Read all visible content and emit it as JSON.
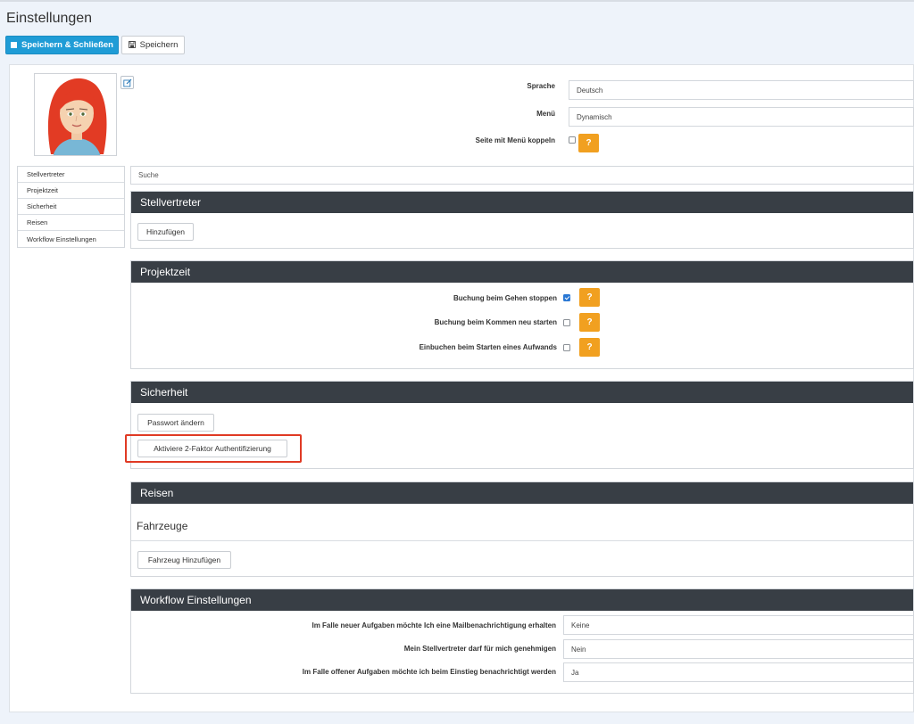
{
  "page": {
    "title": "Einstellungen"
  },
  "toolbar": {
    "save_close_label": "Speichern & Schließen",
    "save_label": "Speichern"
  },
  "profile": {
    "language": {
      "label": "Sprache",
      "value": "Deutsch"
    },
    "menu": {
      "label": "Menü",
      "value": "Dynamisch"
    },
    "couple": {
      "label": "Seite mit Menü koppeln",
      "checked": false
    }
  },
  "sidebar": {
    "items": [
      {
        "label": "Stellvertreter"
      },
      {
        "label": "Projektzeit"
      },
      {
        "label": "Sicherheit"
      },
      {
        "label": "Reisen"
      },
      {
        "label": "Workflow Einstellungen"
      }
    ]
  },
  "search": {
    "placeholder": "Suche"
  },
  "sections": {
    "stellvertreter": {
      "title": "Stellvertreter",
      "add_label": "Hinzufügen"
    },
    "projektzeit": {
      "title": "Projektzeit",
      "options": [
        {
          "label": "Buchung beim Gehen stoppen",
          "checked": true
        },
        {
          "label": "Buchung beim Kommen neu starten",
          "checked": false
        },
        {
          "label": "Einbuchen beim Starten eines Aufwands",
          "checked": false
        }
      ]
    },
    "sicherheit": {
      "title": "Sicherheit",
      "change_password_label": "Passwort ändern",
      "two_factor_label": "Aktiviere 2-Faktor Authentifizierung"
    },
    "reisen": {
      "title": "Reisen",
      "vehicles_heading": "Fahrzeuge",
      "add_vehicle_label": "Fahrzeug Hinzufügen"
    },
    "workflow": {
      "title": "Workflow Einstellungen",
      "rows": [
        {
          "label": "Im Falle neuer Aufgaben möchte Ich eine Mailbenachrichtigung erhalten",
          "value": "Keine"
        },
        {
          "label": "Mein Stellvertreter darf für mich genehmigen",
          "value": "Nein"
        },
        {
          "label": "Im Falle offener Aufgaben möchte ich beim Einstieg benachrichtigt werden",
          "value": "Ja"
        }
      ]
    }
  },
  "help_glyph": "?",
  "colors": {
    "primary": "#1f9cd6",
    "section_header": "#383e45",
    "help": "#f1a020",
    "highlight": "#e03a24",
    "checkbox_on": "#2a78d4"
  }
}
